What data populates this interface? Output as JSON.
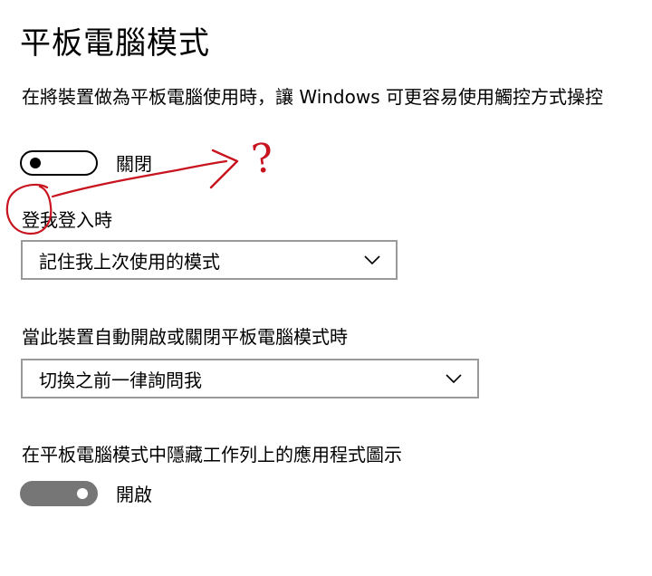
{
  "page": {
    "title": "平板電腦模式",
    "description": "在將裝置做為平板電腦使用時，讓 Windows 可更容易使用觸控方式操控"
  },
  "touch_toggle": {
    "state": "off",
    "label": "關閉"
  },
  "signin": {
    "label": "登我登入時",
    "dropdown_value": "記住我上次使用的模式"
  },
  "auto_switch": {
    "label": "當此裝置自動開啟或關閉平板電腦模式時",
    "dropdown_value": "切換之前一律詢問我"
  },
  "hide_icons": {
    "label": "在平板電腦模式中隱藏工作列上的應用程式圖示",
    "state": "on",
    "toggle_label": "開啟"
  },
  "annotation": {
    "question_mark": "?",
    "color": "#c8141e"
  },
  "colors": {
    "toggle_on_bg": "#767676",
    "dropdown_border": "#9a9a9a"
  },
  "icons": {
    "dropdown": "chevron-down-icon"
  }
}
